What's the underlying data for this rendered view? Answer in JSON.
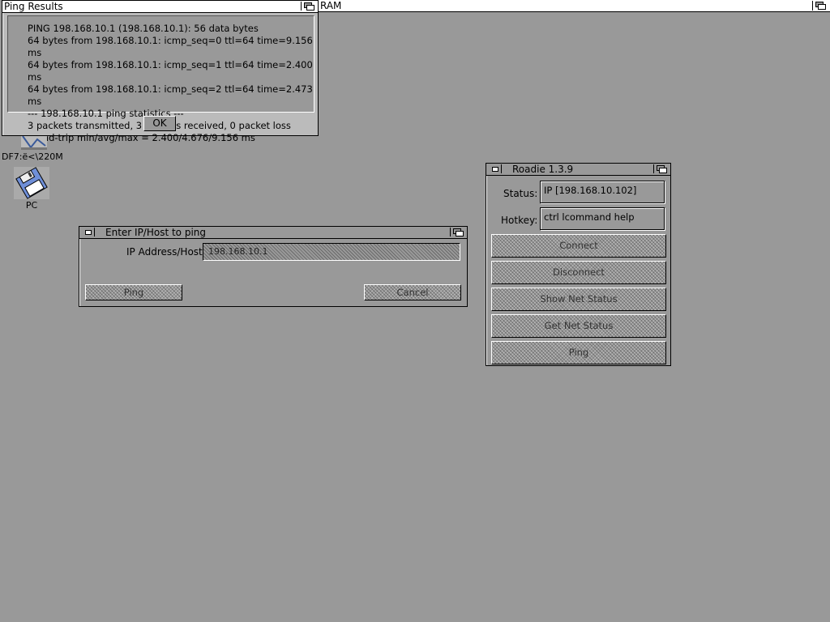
{
  "screen": {
    "title": "RAM"
  },
  "ping_results": {
    "title": "Ping Results",
    "lines": [
      "PING 198.168.10.1 (198.168.10.1): 56 data bytes",
      "64 bytes from 198.168.10.1: icmp_seq=0 ttl=64 time=9.156 ms",
      "64 bytes from 198.168.10.1: icmp_seq=1 ttl=64 time=2.400 ms",
      "64 bytes from 198.168.10.1: icmp_seq=2 ttl=64 time=2.473 ms",
      "--- 198.168.10.1 ping statistics ---",
      "3 packets transmitted, 3 packets received, 0 packet loss",
      "round-trip min/avg/max = 2.400/4.676/9.156 ms"
    ],
    "ok_label": "OK"
  },
  "desktop_icons": [
    {
      "label": "DF7:ë<\\220M"
    },
    {
      "label": "PC"
    }
  ],
  "ip_dialog": {
    "title": "Enter IP/Host to ping",
    "field_label": "IP Address/Host",
    "field_value": "198.168.10.1",
    "ping_label": "Ping",
    "cancel_label": "Cancel"
  },
  "roadie": {
    "title": "Roadie 1.3.9",
    "status_label": "Status:",
    "status_value": "IP [198.168.10.102]",
    "hotkey_label": "Hotkey:",
    "hotkey_value": "ctrl lcommand help",
    "buttons": [
      "Connect",
      "Disconnect",
      "Show Net Status",
      "Get Net Status",
      "Ping"
    ]
  }
}
